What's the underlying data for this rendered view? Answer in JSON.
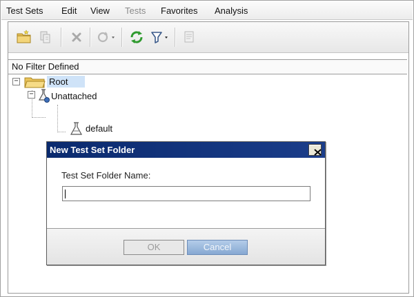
{
  "menu": {
    "items": [
      {
        "label": "Test Sets",
        "disabled": false
      },
      {
        "label": "Edit",
        "disabled": false
      },
      {
        "label": "View",
        "disabled": false
      },
      {
        "label": "Tests",
        "disabled": true
      },
      {
        "label": "Favorites",
        "disabled": false
      },
      {
        "label": "Analysis",
        "disabled": false
      }
    ]
  },
  "toolbar": {
    "icons": [
      "new-folder-icon",
      "new-test-set-icon",
      "delete-icon",
      "refresh-options-icon",
      "refresh-icon",
      "filter-icon",
      "details-icon"
    ]
  },
  "filter": {
    "text": "No Filter Defined"
  },
  "tree": {
    "root": "Root",
    "unattached": "Unattached",
    "default": "default",
    "expander_symbol": "−"
  },
  "dialog": {
    "title": "New Test Set Folder",
    "field_label": "Test Set Folder Name:",
    "field_value": "",
    "ok_label": "OK",
    "cancel_label": "Cancel"
  },
  "colors": {
    "dialog_title_bg": "#0a2a6e",
    "selection_bg": "#cfe3f8",
    "refresh_green": "#2f9a2f",
    "cancel_button_bg": "#8fb0d8"
  }
}
